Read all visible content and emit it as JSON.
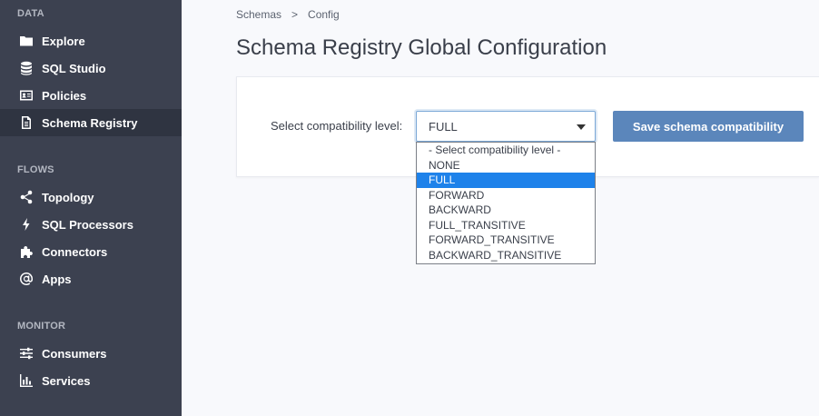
{
  "sidebar": {
    "sections": [
      {
        "title": "DATA",
        "items": [
          {
            "label": "Explore",
            "icon": "folder-icon"
          },
          {
            "label": "SQL Studio",
            "icon": "database-icon"
          },
          {
            "label": "Policies",
            "icon": "id-card-icon"
          },
          {
            "label": "Schema Registry",
            "icon": "document-icon",
            "active": true
          }
        ]
      },
      {
        "title": "FLOWS",
        "items": [
          {
            "label": "Topology",
            "icon": "share-icon"
          },
          {
            "label": "SQL Processors",
            "icon": "bolt-icon"
          },
          {
            "label": "Connectors",
            "icon": "puzzle-icon"
          },
          {
            "label": "Apps",
            "icon": "at-icon"
          }
        ]
      },
      {
        "title": "MONITOR",
        "items": [
          {
            "label": "Consumers",
            "icon": "sliders-icon"
          },
          {
            "label": "Services",
            "icon": "bar-chart-icon"
          }
        ]
      }
    ]
  },
  "breadcrumb": {
    "parent": "Schemas",
    "separator": ">",
    "current": "Config"
  },
  "page": {
    "title": "Schema Registry Global Configuration"
  },
  "form": {
    "label": "Select compatibility level:",
    "selected_value": "FULL",
    "options": [
      "- Select compatibility level -",
      "NONE",
      "FULL",
      "FORWARD",
      "BACKWARD",
      "FULL_TRANSITIVE",
      "FORWARD_TRANSITIVE",
      "BACKWARD_TRANSITIVE"
    ],
    "highlighted_option": "FULL",
    "save_label": "Save schema compatibility"
  },
  "colors": {
    "sidebar_bg": "#3c4150",
    "sidebar_active": "#2f3441",
    "button_bg": "#5b86bb",
    "option_highlight": "#1e82ea"
  }
}
